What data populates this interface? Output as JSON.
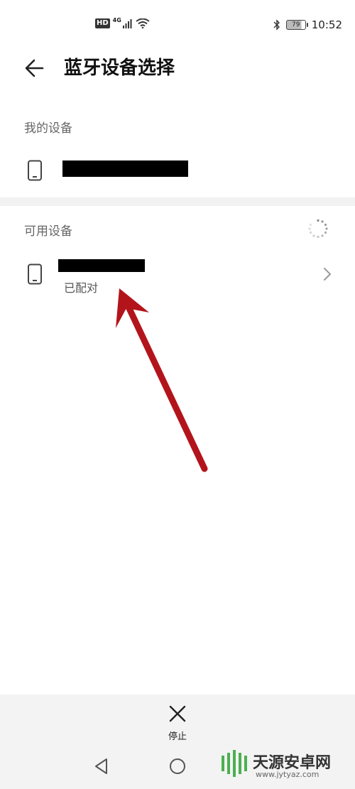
{
  "status_bar": {
    "network_badge": "HD",
    "network_type": "4G",
    "battery": "79",
    "time": "10:52",
    "icons": [
      "hd-icon",
      "signal-icon",
      "wifi-icon",
      "bluetooth-icon",
      "battery-icon"
    ]
  },
  "header": {
    "title": "蓝牙设备选择",
    "back_icon": "back-arrow-icon"
  },
  "my_devices": {
    "label": "我的设备",
    "device_name": ""
  },
  "available_devices": {
    "label": "可用设备",
    "items": [
      {
        "name": "",
        "status": "已配对"
      }
    ]
  },
  "bottom": {
    "stop_label": "停止"
  },
  "colors": {
    "arrow": "#b3141b",
    "section_bg": "#f2f2f2",
    "bottom_bg": "#f3f3f3"
  }
}
